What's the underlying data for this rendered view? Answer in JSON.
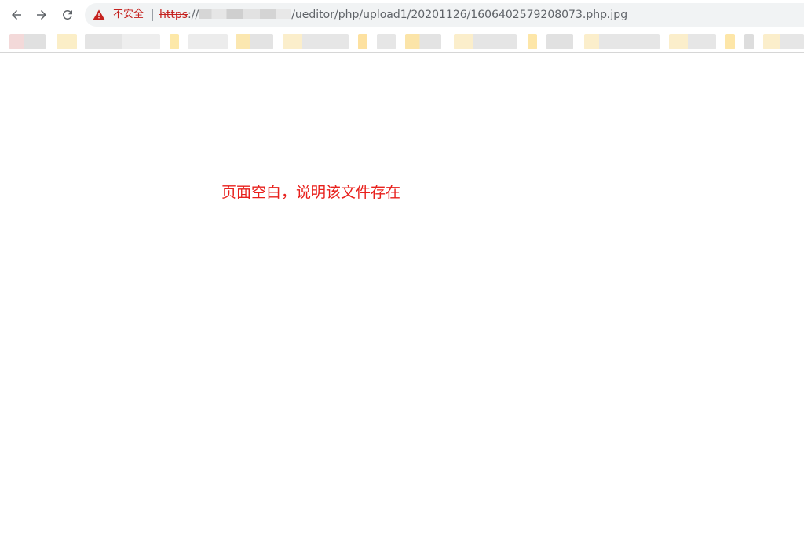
{
  "browser": {
    "security_label": "不安全",
    "url": {
      "scheme": "https",
      "separator": "://",
      "path": "/ueditor/php/upload1/20201126/1606402579208073.php.jpg"
    }
  },
  "icons": {
    "back": "arrow-left-icon",
    "forward": "arrow-right-icon",
    "reload": "reload-icon",
    "security": "warning-triangle-icon"
  },
  "colors": {
    "warning": "#c5221f",
    "annotation": "#e8201c"
  },
  "page": {
    "annotation": "页面空白，说明该文件存在"
  }
}
